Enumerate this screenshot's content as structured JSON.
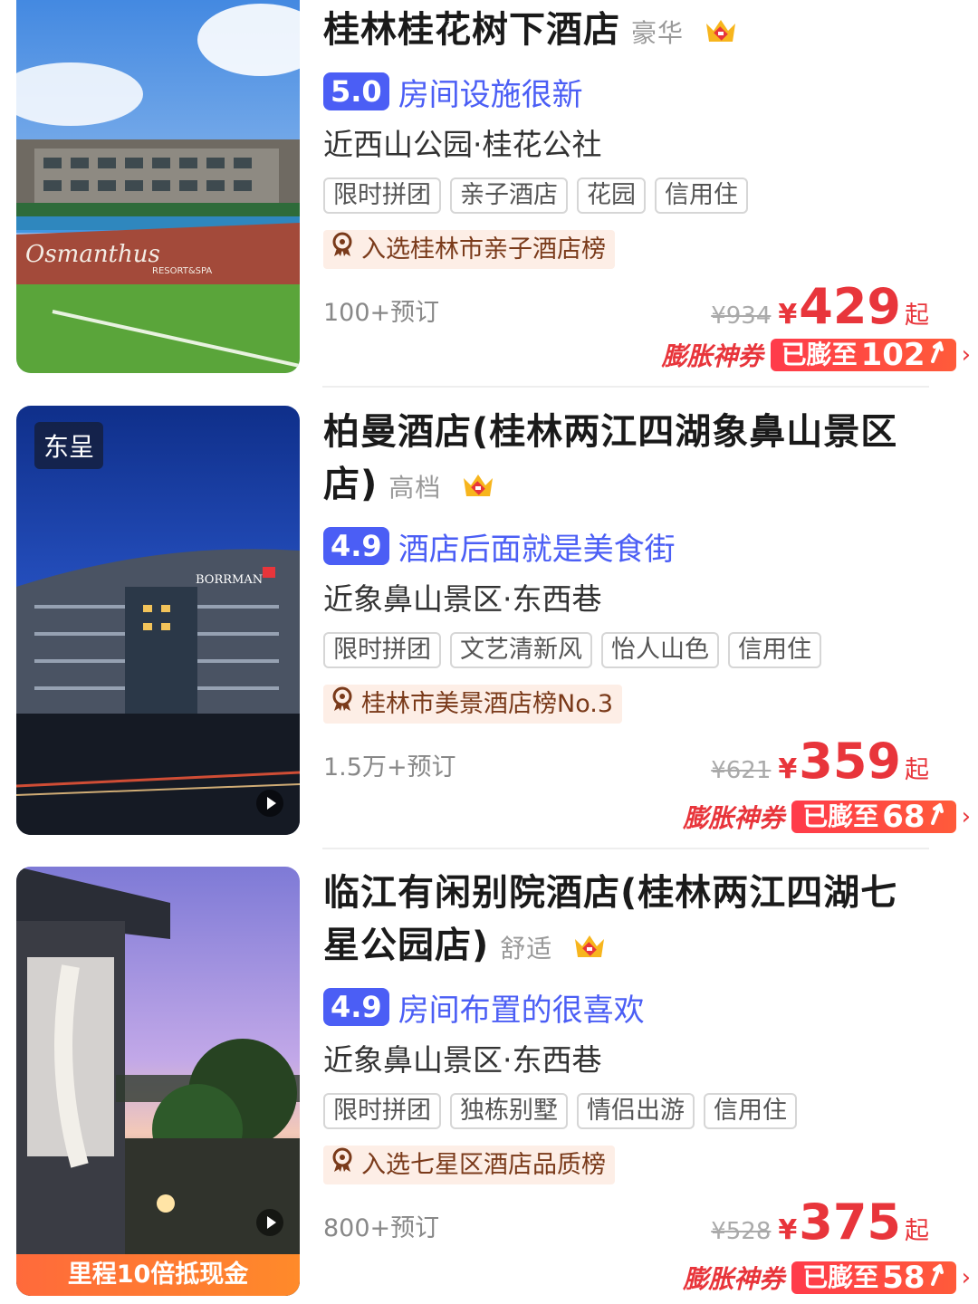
{
  "hotels": [
    {
      "name": "桂林桂花树下酒店",
      "name_line2": "",
      "grade": "豪华",
      "score": "5.0",
      "comment": "房间设施很新",
      "location": "近西山公园·桂花公社",
      "tags": [
        "限时拼团",
        "亲子酒店",
        "花园",
        "信用住"
      ],
      "ranking": "入选桂林市亲子酒店榜",
      "bookings": "100+预订",
      "original_price": "¥934",
      "currency": "¥",
      "price": "429",
      "price_suffix": "起",
      "coupon_name": "膨胀神券",
      "coupon_prefix": "已膨至",
      "coupon_value": "102",
      "thumb_label": "",
      "thumb_banner": ""
    },
    {
      "name": "柏曼酒店(桂林两江四湖象鼻山景区",
      "name_line2": "店)",
      "grade": "高档",
      "score": "4.9",
      "comment": "酒店后面就是美食街",
      "location": "近象鼻山景区·东西巷",
      "tags": [
        "限时拼团",
        "文艺清新风",
        "怡人山色",
        "信用住"
      ],
      "ranking": "桂林市美景酒店榜No.3",
      "bookings": "1.5万+预订",
      "original_price": "¥621",
      "currency": "¥",
      "price": "359",
      "price_suffix": "起",
      "coupon_name": "膨胀神券",
      "coupon_prefix": "已膨至",
      "coupon_value": "68",
      "thumb_label": "东呈",
      "thumb_banner": ""
    },
    {
      "name": "临江有闲别院酒店(桂林两江四湖七",
      "name_line2": "星公园店)",
      "grade": "舒适",
      "score": "4.9",
      "comment": "房间布置的很喜欢",
      "location": "近象鼻山景区·东西巷",
      "tags": [
        "限时拼团",
        "独栋别墅",
        "情侣出游",
        "信用住"
      ],
      "ranking": "入选七星区酒店品质榜",
      "bookings": "800+预订",
      "original_price": "¥528",
      "currency": "¥",
      "price": "375",
      "price_suffix": "起",
      "coupon_name": "膨胀神券",
      "coupon_prefix": "已膨至",
      "coupon_value": "58",
      "thumb_label": "",
      "thumb_banner": "里程10倍抵现金"
    }
  ],
  "colors": {
    "accent_blue": "#4b5ef5",
    "price_red": "#e8353b",
    "ranking_bg": "#fdeee6"
  },
  "icons": [
    "crown-icon",
    "medal-icon",
    "play-icon",
    "up-arrow-icon",
    "chevron-right-icon"
  ]
}
